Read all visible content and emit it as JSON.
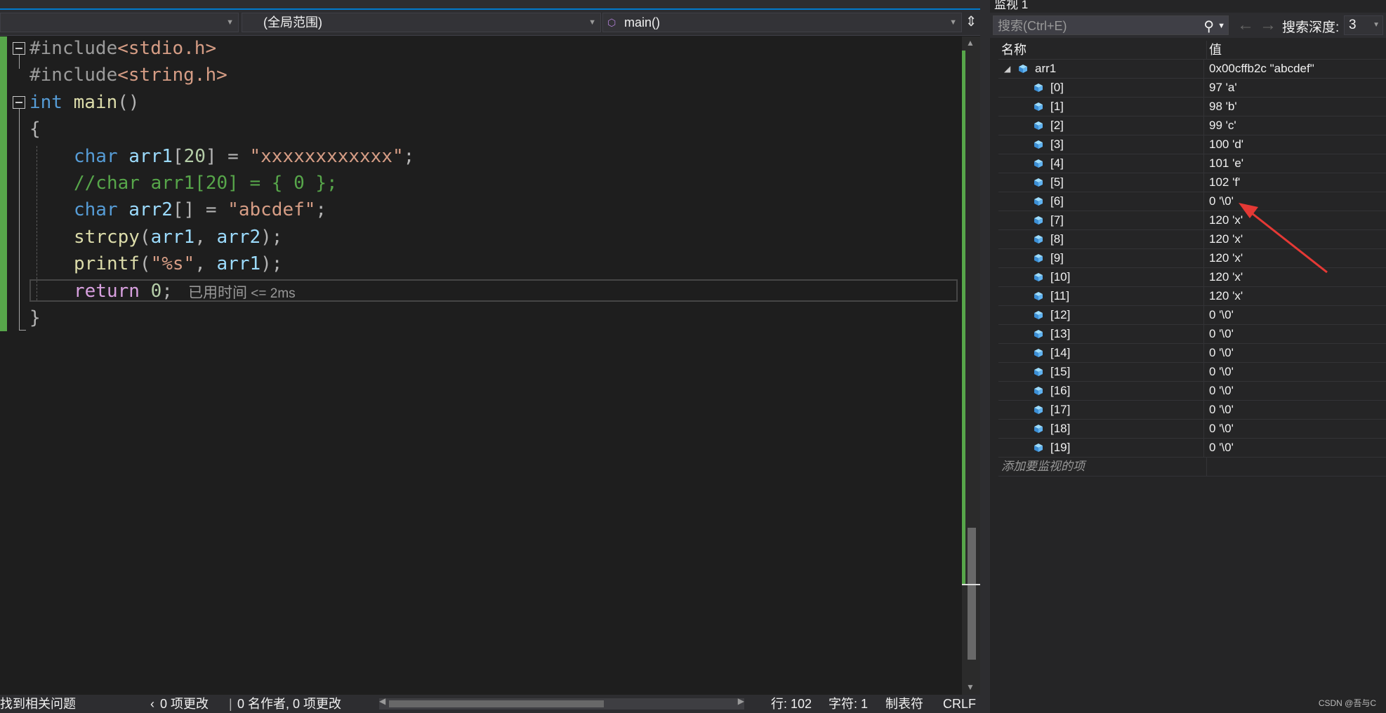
{
  "editor": {
    "nav": {
      "project": "",
      "scope": "(全局范围)",
      "function": "main()"
    },
    "code": {
      "l1_pp": "#include",
      "l1_inc": "<stdio.h>",
      "l2_pp": "#include",
      "l2_inc": "<string.h>",
      "l3_kw": "int",
      "l3_fn": " main",
      "l3_rest": "()",
      "l4": "{",
      "l5_kw": "char",
      "l5_var": " arr1",
      "l5_a": "[",
      "l5_num": "20",
      "l5_b": "] = ",
      "l5_str": "\"xxxxxxxxxxxx\"",
      "l5_end": ";",
      "l6": "//char arr1[20] = { 0 };",
      "l7_kw": "char",
      "l7_var": " arr2",
      "l7_b": "[] = ",
      "l7_str": "\"abcdef\"",
      "l7_end": ";",
      "l8_fn": "strcpy",
      "l8_a": "(",
      "l8_v1": "arr1",
      "l8_b": ", ",
      "l8_v2": "arr2",
      "l8_c": ");",
      "l9_fn": "printf",
      "l9_a": "(",
      "l9_str": "\"%s\"",
      "l9_b": ", ",
      "l9_v1": "arr1",
      "l9_c": ");",
      "l10_ctl": "return",
      "l10_num": " 0",
      "l10_end": ";",
      "l11": "}"
    },
    "elapsed_label": "已用时间",
    "elapsed_value": " <= 2ms"
  },
  "status": {
    "find_issues": "找到相关问题",
    "changes": "0 项更改",
    "authors": "0 名作者, 0 项更改",
    "line": "行: 102",
    "char": "字符: 1",
    "tabs": "制表符",
    "eol": "CRLF"
  },
  "watch": {
    "title": "监视 1",
    "search_placeholder": "搜索(Ctrl+E)",
    "depth_label": "搜索深度:",
    "depth_value": "3",
    "col_name": "名称",
    "col_value": "值",
    "root": {
      "name": "arr1",
      "value": "0x00cffb2c \"abcdef\""
    },
    "items": [
      {
        "name": "[0]",
        "value": "97 'a'"
      },
      {
        "name": "[1]",
        "value": "98 'b'"
      },
      {
        "name": "[2]",
        "value": "99 'c'"
      },
      {
        "name": "[3]",
        "value": "100 'd'"
      },
      {
        "name": "[4]",
        "value": "101 'e'"
      },
      {
        "name": "[5]",
        "value": "102 'f'"
      },
      {
        "name": "[6]",
        "value": "0 '\\0'"
      },
      {
        "name": "[7]",
        "value": "120 'x'"
      },
      {
        "name": "[8]",
        "value": "120 'x'"
      },
      {
        "name": "[9]",
        "value": "120 'x'"
      },
      {
        "name": "[10]",
        "value": "120 'x'"
      },
      {
        "name": "[11]",
        "value": "120 'x'"
      },
      {
        "name": "[12]",
        "value": "0 '\\0'"
      },
      {
        "name": "[13]",
        "value": "0 '\\0'"
      },
      {
        "name": "[14]",
        "value": "0 '\\0'"
      },
      {
        "name": "[15]",
        "value": "0 '\\0'"
      },
      {
        "name": "[16]",
        "value": "0 '\\0'"
      },
      {
        "name": "[17]",
        "value": "0 '\\0'"
      },
      {
        "name": "[18]",
        "value": "0 '\\0'"
      },
      {
        "name": "[19]",
        "value": "0 '\\0'"
      }
    ],
    "add_item": "添加要监视的项"
  },
  "watermark": "CSDN @吾与C",
  "colors": {
    "accent": "#007acc",
    "annotation_arrow": "#e53935",
    "change_bar": "#57a64a"
  }
}
